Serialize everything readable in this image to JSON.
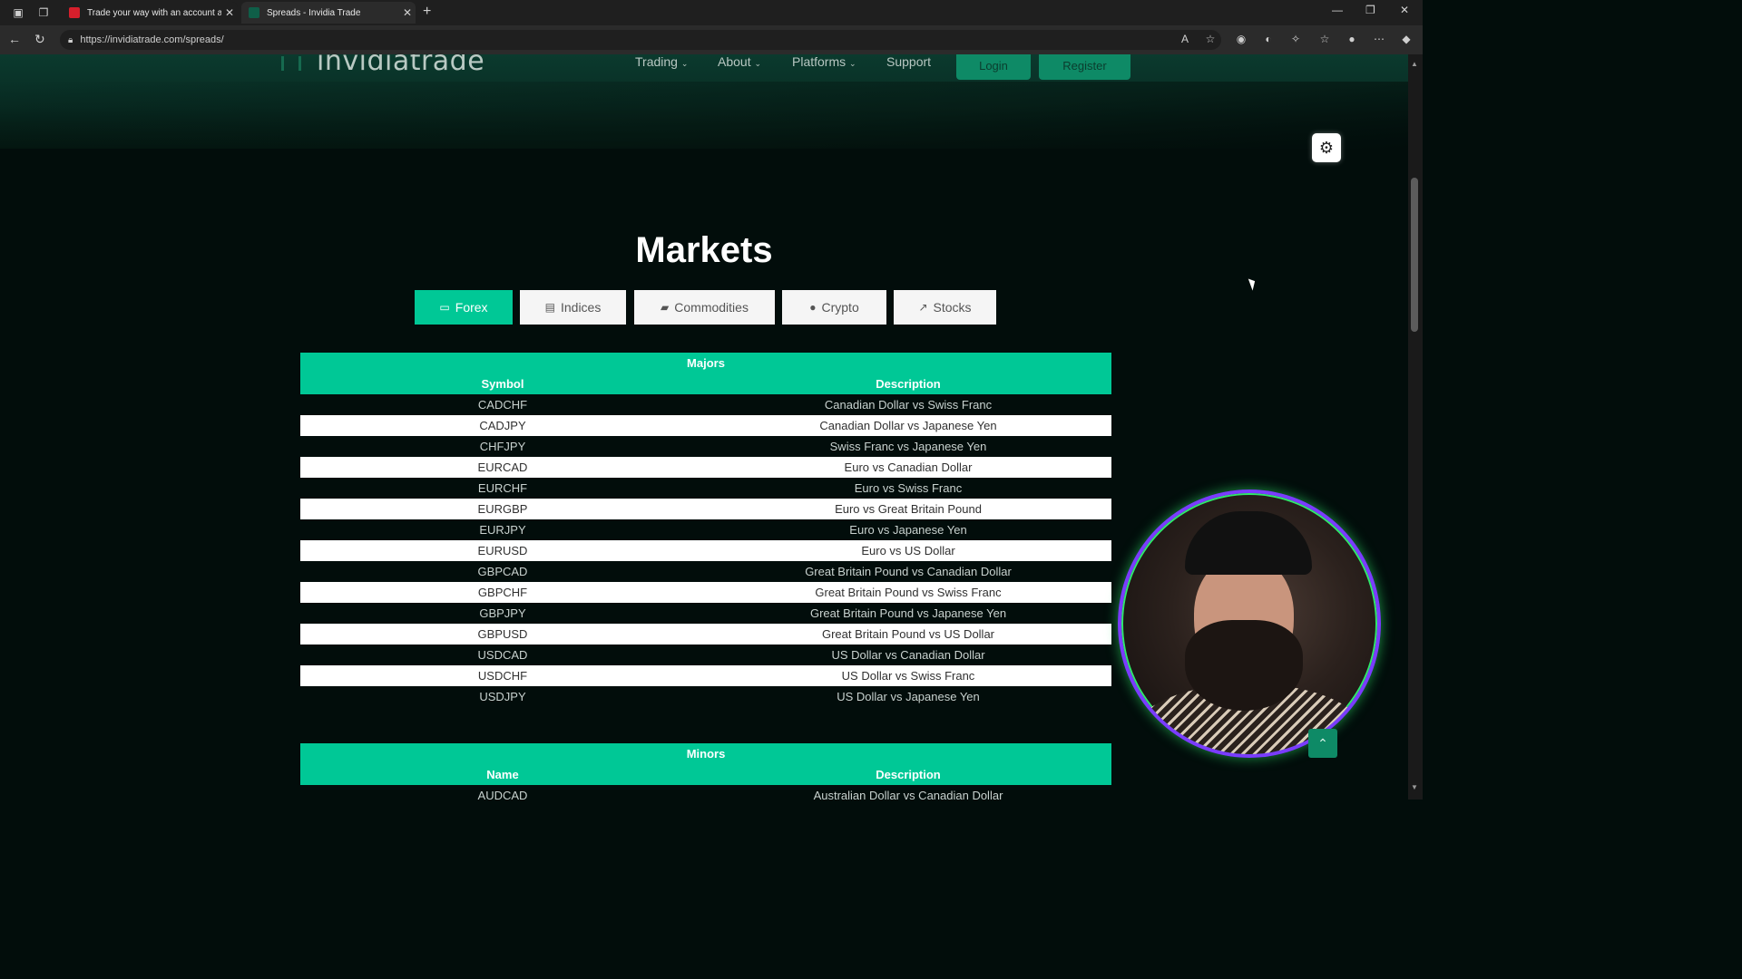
{
  "browser": {
    "tabs": [
      {
        "title": "Trade your way with an account a",
        "active": false
      },
      {
        "title": "Spreads - Invidia Trade",
        "active": true
      }
    ],
    "url": "https://invidiatrade.com/spreads/"
  },
  "site": {
    "logo": "invidiatrade",
    "nav": [
      "Trading",
      "About",
      "Platforms",
      "Support"
    ],
    "login_label": "Login",
    "register_label": "Register",
    "accent_color": "#00c896"
  },
  "markets": {
    "title": "Markets",
    "tabs": [
      "Forex",
      "Indices",
      "Commodities",
      "Crypto",
      "Stocks"
    ],
    "active_tab": "Forex"
  },
  "majors": {
    "title": "Majors",
    "columns": [
      "Symbol",
      "Description"
    ],
    "rows": [
      [
        "CADCHF",
        "Canadian Dollar vs Swiss Franc"
      ],
      [
        "CADJPY",
        "Canadian Dollar vs Japanese Yen"
      ],
      [
        "CHFJPY",
        "Swiss Franc vs Japanese Yen"
      ],
      [
        "EURCAD",
        "Euro vs Canadian Dollar"
      ],
      [
        "EURCHF",
        "Euro vs Swiss Franc"
      ],
      [
        "EURGBP",
        "Euro vs Great Britain Pound"
      ],
      [
        "EURJPY",
        "Euro vs Japanese Yen"
      ],
      [
        "EURUSD",
        "Euro vs US Dollar"
      ],
      [
        "GBPCAD",
        "Great Britain Pound vs Canadian Dollar"
      ],
      [
        "GBPCHF",
        "Great Britain Pound vs Swiss Franc"
      ],
      [
        "GBPJPY",
        "Great Britain Pound vs Japanese Yen"
      ],
      [
        "GBPUSD",
        "Great Britain Pound vs US Dollar"
      ],
      [
        "USDCAD",
        "US Dollar vs Canadian Dollar"
      ],
      [
        "USDCHF",
        "US Dollar vs Swiss Franc"
      ],
      [
        "USDJPY",
        "US Dollar vs Japanese Yen"
      ]
    ]
  },
  "minors": {
    "title": "Minors",
    "columns": [
      "Name",
      "Description"
    ],
    "rows": [
      [
        "AUDCAD",
        "Australian Dollar vs Canadian Dollar"
      ]
    ]
  }
}
